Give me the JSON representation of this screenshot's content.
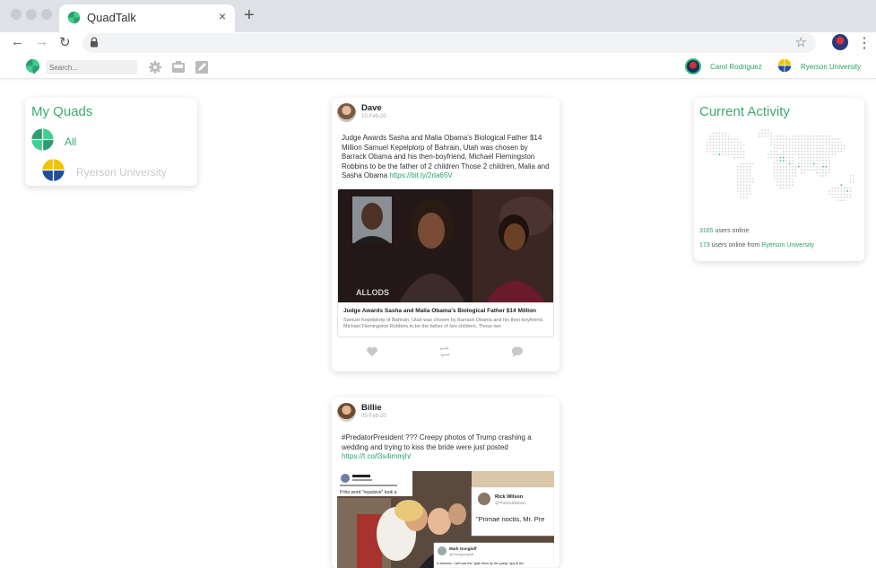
{
  "browser": {
    "tab_title": "QuadTalk",
    "close_glyph": "×",
    "newtab_glyph": "+",
    "back_glyph": "←",
    "forward_glyph": "→",
    "reload_glyph": "↻",
    "star_glyph": "☆",
    "kebab_glyph": "⋮"
  },
  "header": {
    "search_placeholder": "Search...",
    "user_name": "Carol Rodriguez",
    "university": "Ryerson University",
    "icons": [
      "settings-icon",
      "inbox-icon",
      "compose-icon"
    ]
  },
  "quads": {
    "title": "My Quads",
    "items": [
      {
        "label": "All"
      },
      {
        "label": "Ryerson University"
      }
    ]
  },
  "activity": {
    "title": "Current Activity",
    "users_online": "3165",
    "users_online_text": " users online",
    "users_from": "173",
    "users_from_text": " users online from ",
    "university": "Ryerson University"
  },
  "posts": [
    {
      "author": "Dave",
      "date": "10-Feb-20",
      "text": "Judge Awards Sasha and Malia Obama's Biological Father $14 Million Samuel Kepelplorp of Bahrain, Utah was chosen by Barrack Obama and his then-boyfriend, Michael Flemingston Robbins to be the father of 2 children Those 2 children, Malia and Sasha Obama ",
      "link": "https://bit.ly/2rla65V",
      "preview_title": "Judge Awards Sasha and Malia Obama's Biological Father $14 Million",
      "preview_desc": "Samuel Kepelplorp of Bahrain, Utah was chosen by Barrack Obama and his then-boyfriend, Michael Flemingston Robbins to be the father of two children. Those two",
      "watermark": "ALLODS"
    },
    {
      "author": "Billie",
      "date": "05-Feb-20",
      "text": "#PredatorPresident ??? Creepy photos of Trump crashing a wedding and trying to kiss the bride were just posted ",
      "link": "https://t.co/l3s4immjh/",
      "tweets": [
        {
          "name": "Rick Wilson",
          "handle": "@TheRickWilson",
          "text": "\"Primae noctis, Mr. Pre"
        },
        {
          "name": "Mark Gongloff",
          "handle": "@markgongloff",
          "text": "In fairness, I will note the \"grab them by the pussy\" guy fit the"
        }
      ],
      "tweet_reply": "If the word \"repulsive\" took a"
    }
  ],
  "colors": {
    "accent": "#2aa36b",
    "title_green": "#3aaa77",
    "map_dot": "#d4d4d4",
    "map_active": "#2ec27e"
  }
}
